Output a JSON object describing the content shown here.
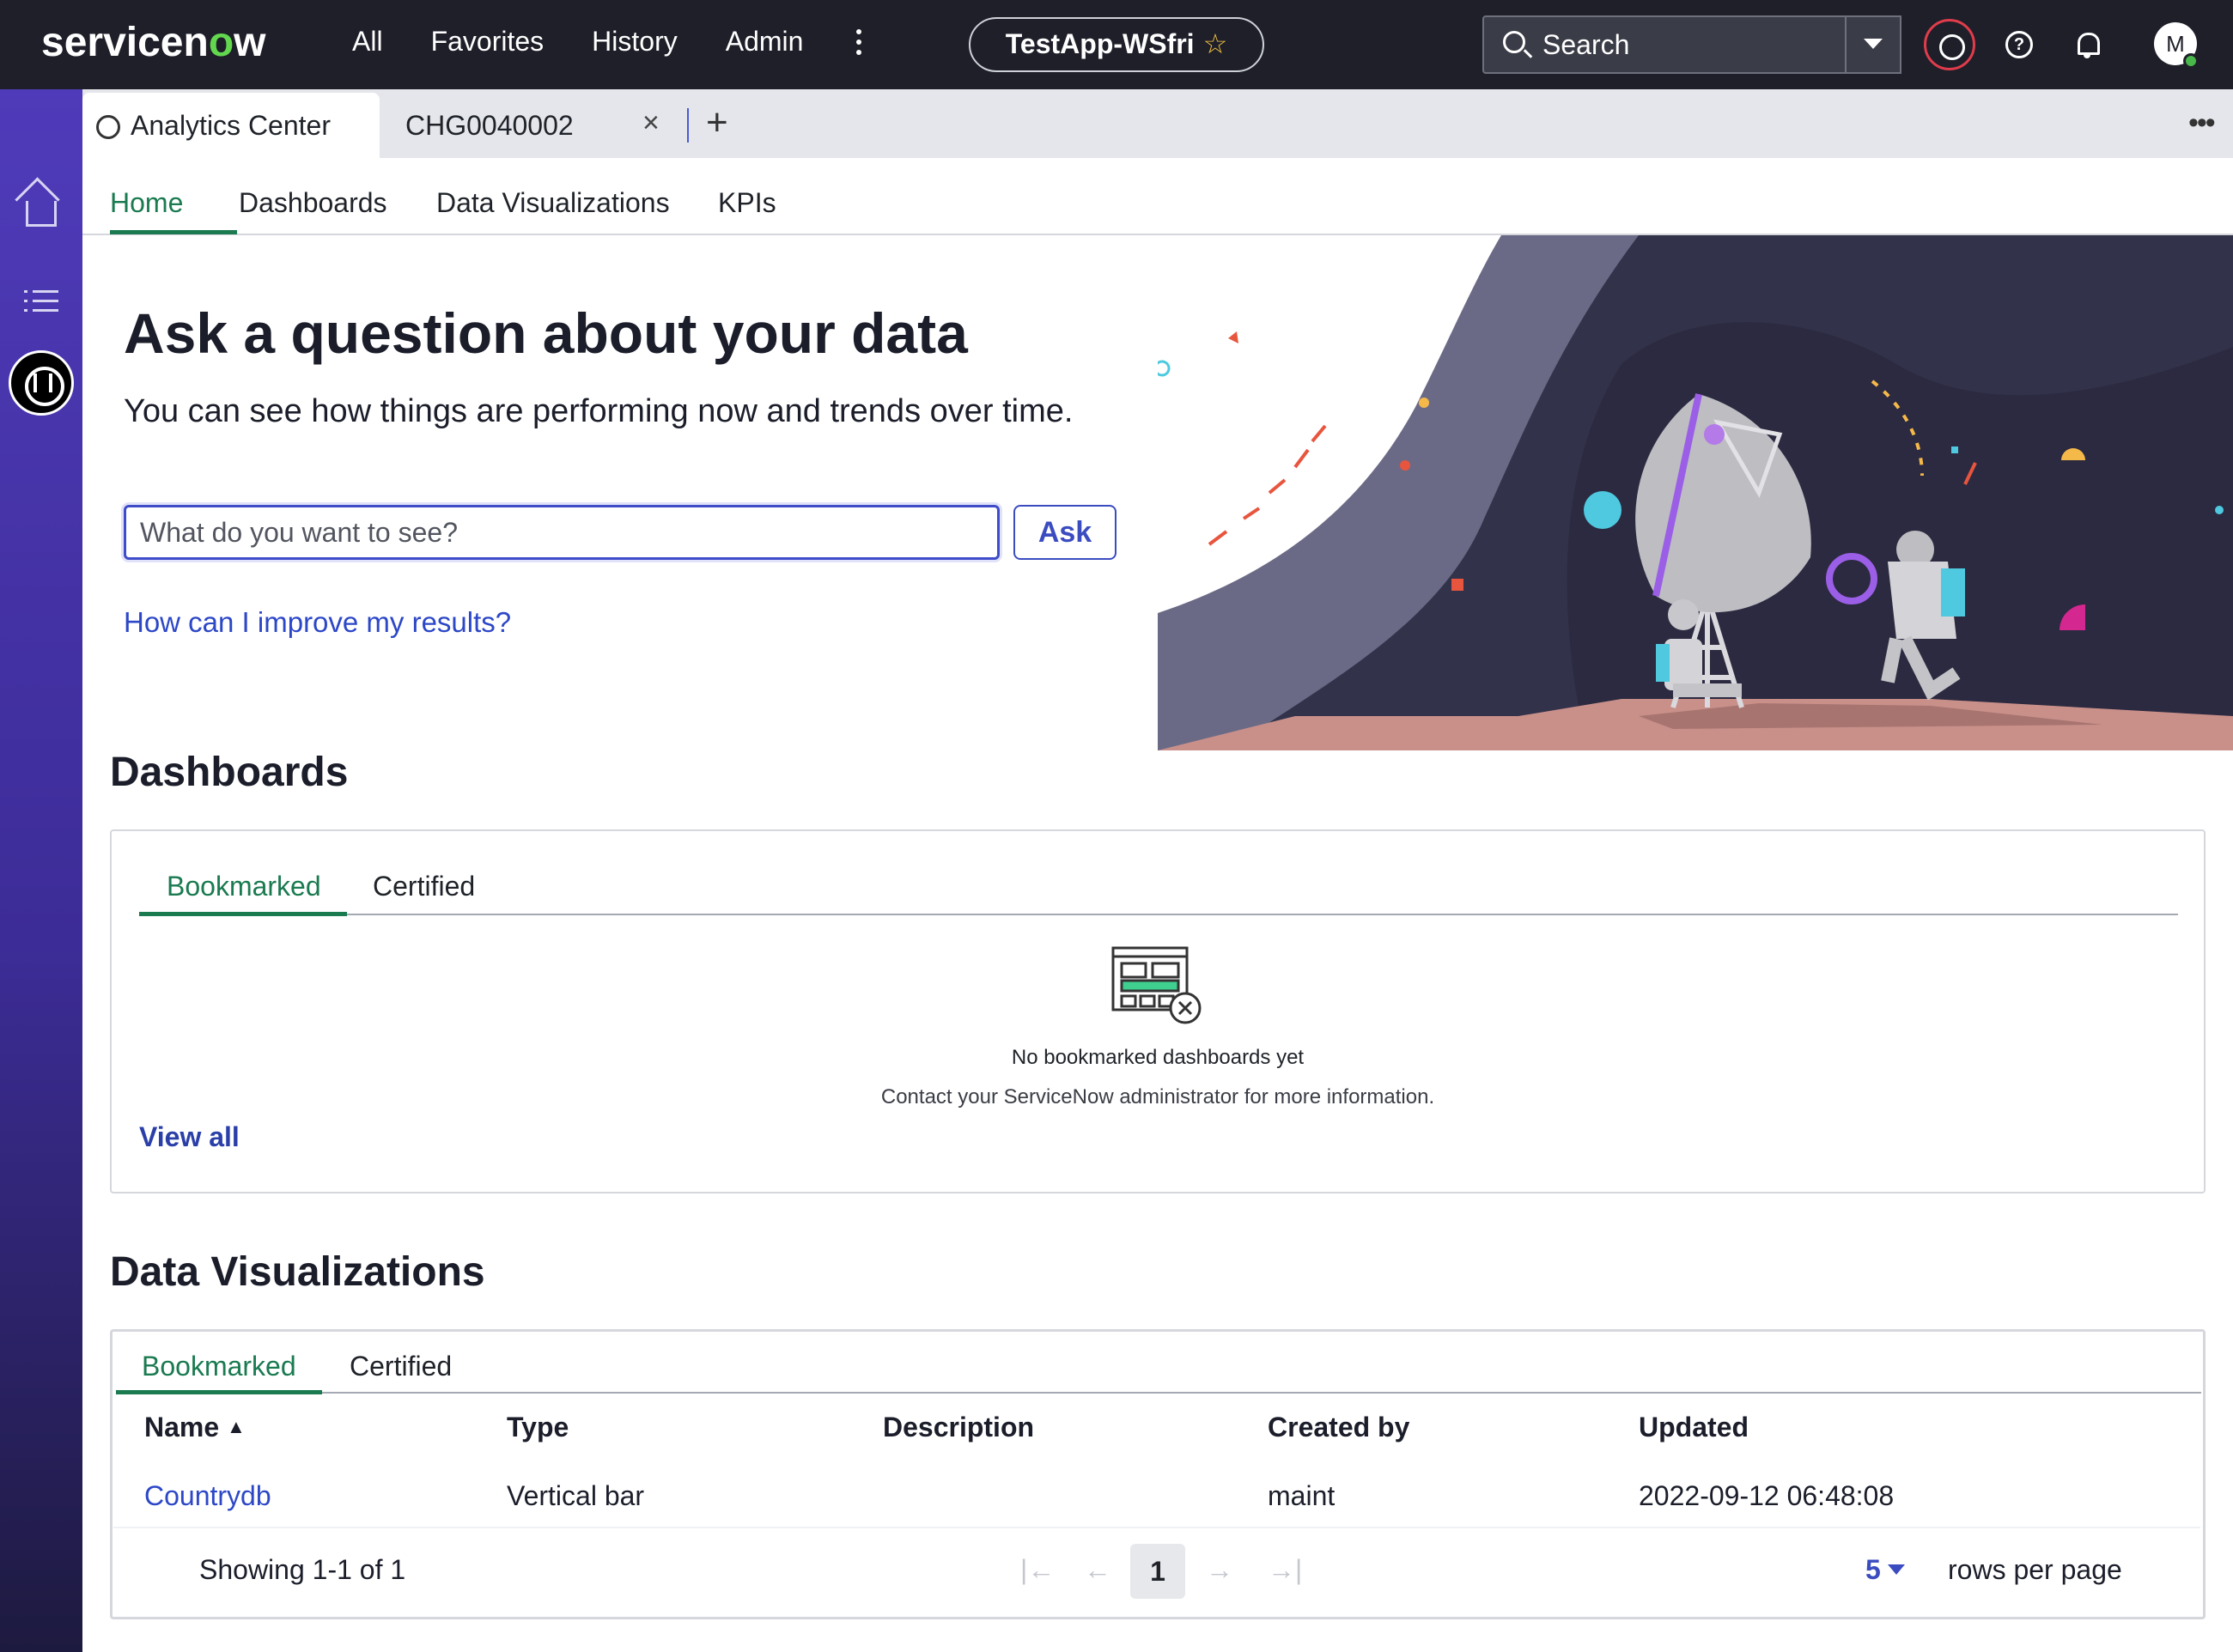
{
  "header": {
    "logo_text_a": "servicen",
    "logo_text_o": "o",
    "logo_text_b": "w",
    "nav": [
      "All",
      "Favorites",
      "History",
      "Admin"
    ],
    "app_name": "TestApp-WSfri",
    "search_placeholder": "Search",
    "avatar_initial": "M"
  },
  "tabs": {
    "active_label": "Analytics Center",
    "second_label": "CHG0040002",
    "close_glyph": "×",
    "add_glyph": "+",
    "more_glyph": "•••"
  },
  "subnav": [
    "Home",
    "Dashboards",
    "Data Visualizations",
    "KPIs"
  ],
  "hero": {
    "title": "Ask a question about your data",
    "subtitle": "You can see how things are performing now and trends over time.",
    "input_placeholder": "What do you want to see?",
    "ask_label": "Ask",
    "improve_link": "How can I improve my results?"
  },
  "dashboards": {
    "title": "Dashboards",
    "tabs": [
      "Bookmarked",
      "Certified"
    ],
    "empty_title": "No bookmarked dashboards yet",
    "empty_sub": "Contact your ServiceNow administrator for more information.",
    "view_all": "View all"
  },
  "visualizations": {
    "title": "Data Visualizations",
    "tabs": [
      "Bookmarked",
      "Certified"
    ],
    "columns": [
      "Name",
      "Type",
      "Description",
      "Created by",
      "Updated"
    ],
    "rows": [
      {
        "name": "Countrydb",
        "type": "Vertical bar",
        "description": "",
        "created_by": "maint",
        "updated": "2022-09-12 06:48:08"
      }
    ],
    "showing": "Showing 1-1 of 1",
    "page": "1",
    "rows_per_page_value": "5",
    "rows_per_page_label": "rows per page"
  },
  "colors": {
    "header_bg": "#1e1f29",
    "accent_green": "#1a7a50",
    "link_blue": "#2c47c7",
    "rail_purple": "#4f3bb9"
  },
  "icons": [
    "search-icon",
    "globe-icon",
    "help-icon",
    "bell-icon",
    "home-icon",
    "list-icon",
    "analytics-icon",
    "dashboard-empty-icon",
    "sort-asc-icon",
    "first-page-icon",
    "prev-page-icon",
    "next-page-icon",
    "last-page-icon"
  ]
}
